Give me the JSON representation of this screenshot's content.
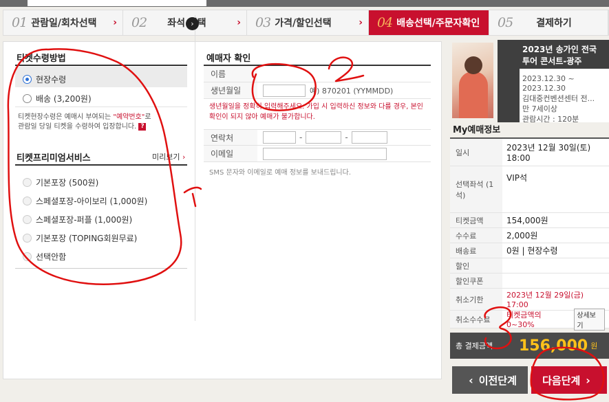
{
  "steps": [
    {
      "num": "01",
      "label": "관람일/회차선택",
      "active": false
    },
    {
      "num": "02",
      "label": "좌석 선택",
      "active": false
    },
    {
      "num": "03",
      "label": "가격/할인선택",
      "active": false
    },
    {
      "num": "04",
      "label": "배송선택/주문자확인",
      "active": true
    },
    {
      "num": "05",
      "label": "결제하기",
      "active": false
    }
  ],
  "receive": {
    "title": "티켓수령방법",
    "option_onsite": "현장수령",
    "option_delivery": "배송 (3,200원)",
    "note_pre": "티켓현장수령은 예매시 부여되는 ",
    "note_red": "\"예약번호\"",
    "note_mid": "로",
    "note_line2": "관람일 당일 티켓을 수령하여 입장합니다.",
    "note_q": "?"
  },
  "premium": {
    "title": "티켓프리미엄서비스",
    "preview": "미리보기",
    "options": [
      "기본포장 (500원)",
      "스페셜포장-아이보리 (1,000원)",
      "스페셜포장-퍼플 (1,000원)",
      "기본포장 (TOPING회원무료)",
      "선택안함"
    ]
  },
  "booker": {
    "title": "예매자 확인",
    "name_label": "이름",
    "birth_label": "생년월일",
    "birth_hint": "예) 870201 (YYMMDD)",
    "warning": "생년월일을 정확히 입력해주세요. 가입 시 입력하신 정보와 다를 경우, 본인확인이 되지 않아 예매가 불가합니다.",
    "phone_label": "연락처",
    "email_label": "이메일",
    "sms_note": "SMS 문자와 이메일로 예매 정보를 보내드립니다."
  },
  "show": {
    "title": "2023년 송가인 전국 투어 콘서트-광주",
    "dates": "2023.12.30 ~ 2023.12.30",
    "venue": "김대중컨벤션센터 전...",
    "age": "만 7세이상",
    "runtime": "관람시간 : 120분"
  },
  "my": {
    "title": "My예매정보",
    "rows": [
      {
        "key": "일시",
        "val": "2023년 12월 30일(토) 18:00"
      },
      {
        "key": "선택좌석 (1석)",
        "val": "VIP석"
      },
      {
        "key": "티켓금액",
        "val": "154,000원"
      },
      {
        "key": "수수료",
        "val": "2,000원"
      },
      {
        "key": "배송료",
        "val": "0원 | 현장수령"
      },
      {
        "key": "할인",
        "val": ""
      },
      {
        "key": "할인쿠폰",
        "val": ""
      },
      {
        "key": "취소기한",
        "val": "2023년 12월 29일(금) 17:00"
      },
      {
        "key": "취소수수료",
        "val": "티켓금액의 0~30%"
      }
    ],
    "detail_btn": "상세보기",
    "total_label": "총 결제금액",
    "total_value": "156,000",
    "total_unit": "원"
  },
  "buttons": {
    "prev": "이전단계",
    "next": "다음단계"
  },
  "colors": {
    "accent": "#c8102e",
    "total": "#ffc21a",
    "ink": "#e01010"
  },
  "annotations": {
    "one": "1",
    "two": "2",
    "three": "3"
  }
}
